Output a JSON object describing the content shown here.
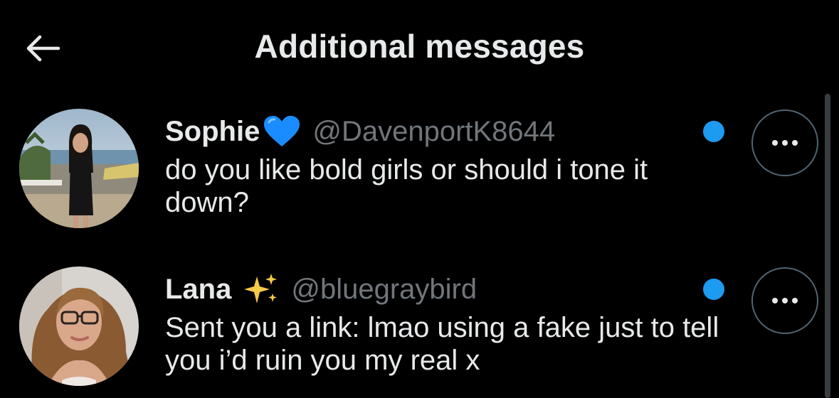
{
  "header": {
    "title": "Additional messages",
    "back_icon": "arrow-left-icon"
  },
  "messages": [
    {
      "name": "Sophie",
      "emoji": "blue-heart",
      "handle": "@DavenportK8644",
      "text": "do you like bold girls or should i tone it down?",
      "unread": true,
      "more_icon": "more-horizontal-icon"
    },
    {
      "name": "Lana",
      "emoji": "sparkles",
      "handle": "@bluegraybird",
      "text": "Sent you a link: lmao using a fake just to tell you i’d ruin you my real x",
      "unread": true,
      "more_icon": "more-horizontal-icon"
    }
  ],
  "colors": {
    "background": "#000000",
    "primary_text": "#e7e9ea",
    "secondary_text": "#71767b",
    "unread_dot": "#1d9bf0",
    "button_border": "#536471",
    "heart": "#1a8cff",
    "sparkle": "#f7c948"
  }
}
